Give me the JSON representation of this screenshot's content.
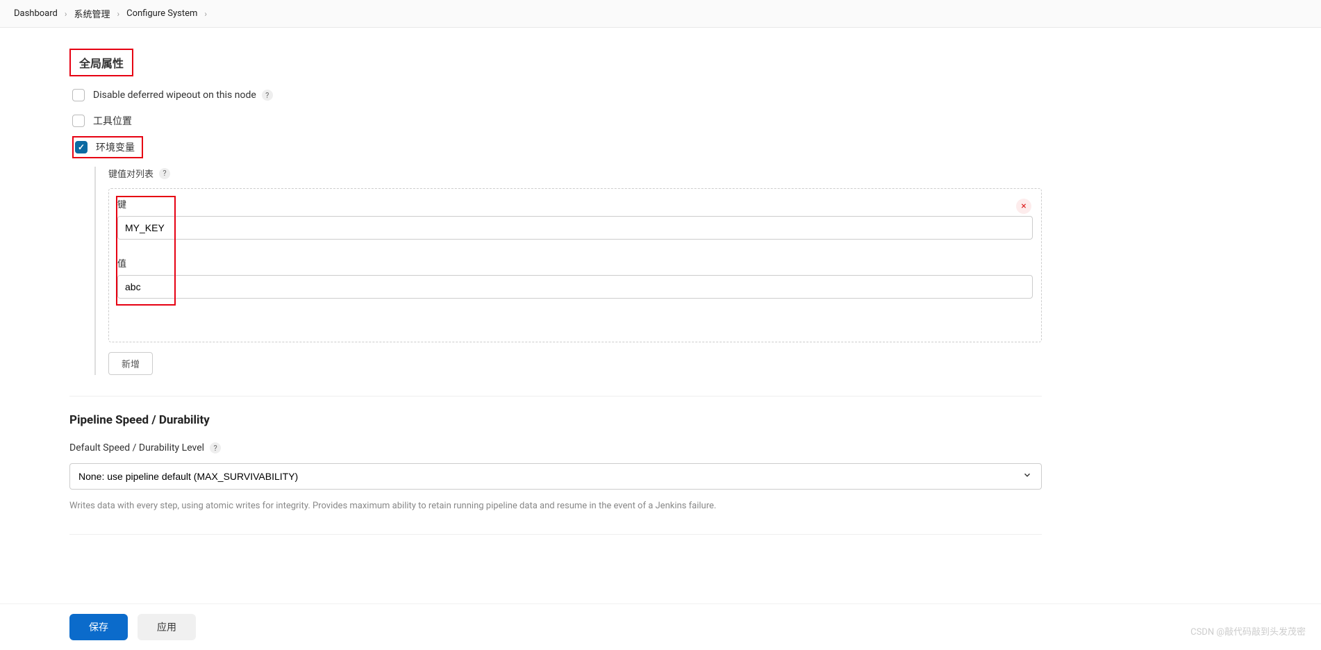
{
  "breadcrumb": {
    "items": [
      "Dashboard",
      "系统管理",
      "Configure System"
    ]
  },
  "global_properties": {
    "title": "全局属性",
    "disable_wipeout": {
      "label": "Disable deferred wipeout on this node",
      "checked": false
    },
    "tool_locations": {
      "label": "工具位置",
      "checked": false
    },
    "env_vars": {
      "label": "环境变量",
      "checked": true,
      "kv_list_label": "键值对列表",
      "key_label": "键",
      "value_label": "值",
      "entries": [
        {
          "key": "MY_KEY",
          "value": "abc"
        }
      ],
      "add_button": "新增"
    }
  },
  "pipeline": {
    "title": "Pipeline Speed / Durability",
    "level_label": "Default Speed / Durability Level",
    "selected": "None: use pipeline default (MAX_SURVIVABILITY)",
    "help_text": "Writes data with every step, using atomic writes for integrity.  Provides maximum ability to retain running pipeline data and resume in the event of a Jenkins failure."
  },
  "footer": {
    "save": "保存",
    "apply": "应用"
  },
  "watermark": "CSDN @敲代码敲到头发茂密"
}
